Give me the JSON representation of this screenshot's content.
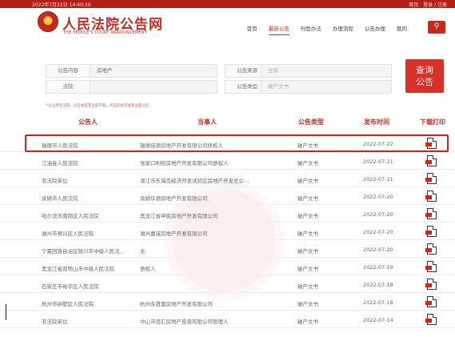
{
  "topbar": {
    "datetime": "2022年7月22日  14:40:29",
    "links": [
      "首页",
      "登录 / 注册"
    ]
  },
  "header": {
    "title": "人民法院公告网",
    "subtitle": "THE PEOPLE'S COURT ANNOUNCEMENT",
    "nav": [
      "首页",
      "最新公告",
      "刊登办法",
      "办理流程",
      "公告办理",
      "我的"
    ],
    "active_nav": "最新公告"
  },
  "search_form": {
    "content_label": "公告内容",
    "content_value": "房地产",
    "source_label": "公告来源",
    "source_value": "全部",
    "court_label": "法院",
    "court_value": "",
    "type_label": "公告类型",
    "type_value": "破产文书",
    "query_button": "查询\n公告",
    "hint": "*以上所有法院、公告类型等全部不限，点击检索可查看全部公告"
  },
  "table": {
    "headers": [
      "公告人",
      "当事人",
      "公告类型",
      "发布时间",
      "下载打印"
    ],
    "rows": [
      {
        "announcer": "瑞丽市人民法院",
        "party": "瑞丽佳源房地产开发有限公司债权人",
        "type": "破产文书",
        "date": "2022-07-22"
      },
      {
        "announcer": "江油县人民法院",
        "party": "张家口利纺房地产开发有限公司债权人",
        "type": "破产文书",
        "date": "2022-07-21"
      },
      {
        "announcer": "非法院单位",
        "party": "湛江市东海岛经济开发试验区房地产开发总公...",
        "type": "破产文书",
        "date": "2022-07-21"
      },
      {
        "announcer": "余姚市人民法院",
        "party": "余姚华源房地产开发有限公司",
        "type": "破产文书",
        "date": "2022-07-20"
      },
      {
        "announcer": "哈尔滨市南岗区人民法院",
        "party": "黑龙江省申民房地产开发有限公司",
        "type": "破产文书",
        "date": "2022-07-20"
      },
      {
        "announcer": "湖州市吴兴区人民法院",
        "party": "湖州嘉诚房地产开发有限公司",
        "type": "破产文书",
        "date": "2022-07-20"
      },
      {
        "announcer": "宁夏回族自治区银川市中级人民法...",
        "party": "无",
        "type": "破产文书",
        "date": "2022-07-20"
      },
      {
        "announcer": "黑龙江省双鸭山市中级人民法院",
        "party": "债权人",
        "type": "破产文书",
        "date": "2022-07-19"
      },
      {
        "announcer": "石家庄市裕华区人民法院",
        "party": "",
        "type": "破产文书",
        "date": "2022-07-18"
      },
      {
        "announcer": "杭州市拱墅区人民法院",
        "party": "杭州永晟富房地产开发有限公司",
        "type": "破产文书",
        "date": "2022-07-18"
      },
      {
        "announcer": "非法院单位",
        "party": "中山市佰汇房地产投资有限公司管理人",
        "type": "破产文书",
        "date": "2022-07-14"
      }
    ]
  },
  "colors": {
    "brand_red": "#c8291f",
    "highlight": "#d8201a"
  }
}
